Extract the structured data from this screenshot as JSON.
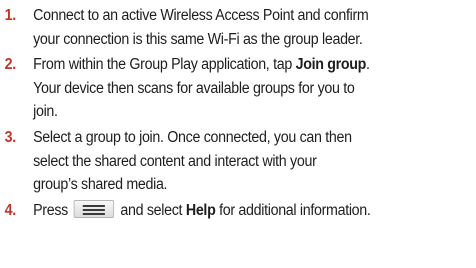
{
  "steps": [
    {
      "number": "1.",
      "lines": [
        {
          "text": "Connect to an active Wireless Access Point and confirm"
        },
        {
          "text": "your connection is this same Wi-Fi as the group leader."
        }
      ]
    },
    {
      "number": "2.",
      "lines": [
        {
          "pre": "From within the Group Play application, tap ",
          "bold": "Join group",
          "post": "."
        },
        {
          "text": "Your device then scans for available groups for you to"
        },
        {
          "text": "join."
        }
      ]
    },
    {
      "number": "3.",
      "lines": [
        {
          "text": "Select a group to join. Once connected, you can then"
        },
        {
          "text": "select the shared content and interact with your"
        },
        {
          "text": "group’s shared media."
        }
      ]
    },
    {
      "number": "4.",
      "pre": "Press",
      "icon": "menu-key-icon",
      "mid": "and select ",
      "bold": "Help",
      "post": " for additional information."
    }
  ]
}
